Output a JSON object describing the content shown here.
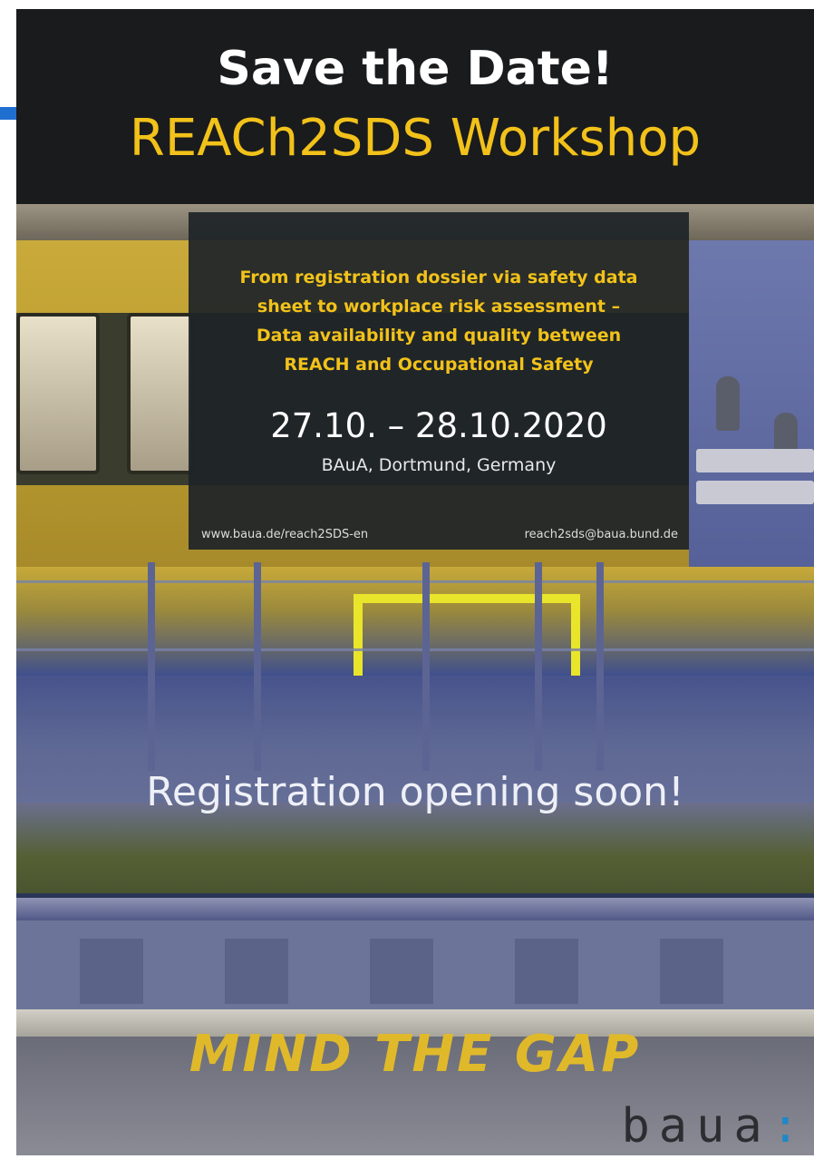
{
  "header": {
    "title": "Save the Date!",
    "subtitle": "REACh2SDS Workshop"
  },
  "info_box": {
    "description_lines": [
      "From registration dossier via safety data",
      "sheet to workplace risk assessment –",
      "Data availability and quality between",
      "REACH and Occupational Safety"
    ],
    "dates": "27.10. – 28.10.2020",
    "venue": "BAuA, Dortmund, Germany",
    "url": "www.baua.de/reach2SDS-en",
    "email": "reach2sds@baua.bund.de"
  },
  "registration_notice": "Registration opening soon!",
  "floor_marking": "MIND THE GAP",
  "logo": {
    "text": "baua",
    "suffix": ":"
  },
  "colors": {
    "accent_yellow": "#f2c21a",
    "header_bg": "#1a1b1d",
    "logo_colon_blue": "#1e88c8",
    "accent_bar_blue": "#1f6fd1"
  }
}
